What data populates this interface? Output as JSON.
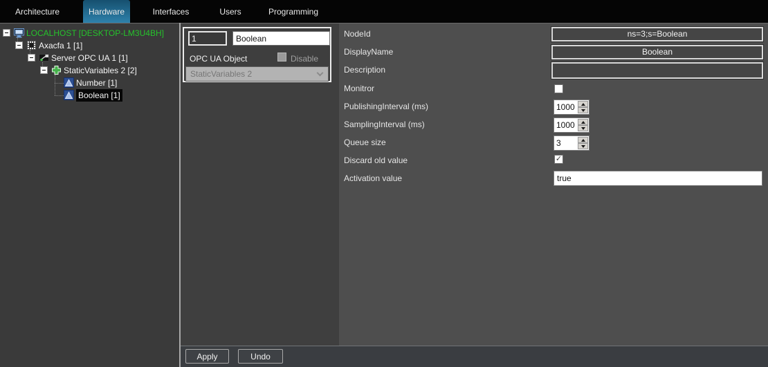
{
  "tabs": [
    {
      "label": "Architecture",
      "active": false
    },
    {
      "label": "Hardware",
      "active": true
    },
    {
      "label": "Interfaces",
      "active": false
    },
    {
      "label": "Users",
      "active": false
    },
    {
      "label": "Programming",
      "active": false
    }
  ],
  "tree": [
    {
      "label": "LOCALHOST [DESKTOP-LM3U4BH]",
      "icon": "monitor-icon",
      "level": 0,
      "expandable": true,
      "selected": false,
      "color": "#25c32b"
    },
    {
      "label": "Axacfa 1 [1]",
      "icon": "plc-icon",
      "level": 1,
      "expandable": true,
      "selected": false
    },
    {
      "label": "Server OPC UA 1 [1]",
      "icon": "opcua-server-icon",
      "level": 2,
      "expandable": true,
      "selected": false
    },
    {
      "label": "StaticVariables 2 [2]",
      "icon": "variables-group-icon",
      "level": 3,
      "expandable": true,
      "selected": false
    },
    {
      "label": "Number [1]",
      "icon": "variable-icon",
      "level": 4,
      "expandable": false,
      "selected": false
    },
    {
      "label": "Boolean [1]",
      "icon": "variable-icon",
      "level": 4,
      "expandable": false,
      "selected": true
    }
  ],
  "object_box": {
    "index_value": "1",
    "name_value": "Boolean",
    "type_label": "OPC UA Object",
    "disable_label": "Disable",
    "disable_checked": false,
    "parent_value": "StaticVariables 2"
  },
  "properties": [
    {
      "label": "NodeId",
      "type": "display",
      "value": "ns=3;s=Boolean"
    },
    {
      "label": "DisplayName",
      "type": "display",
      "value": "Boolean"
    },
    {
      "label": "Description",
      "type": "display",
      "value": ""
    },
    {
      "label": "Monitror",
      "type": "checkbox",
      "checked": false
    },
    {
      "label": "PublishingInterval (ms)",
      "type": "spinner",
      "value": "1000"
    },
    {
      "label": "SamplingInterval (ms)",
      "type": "spinner",
      "value": "1000"
    },
    {
      "label": "Queue size",
      "type": "spinner",
      "value": "3"
    },
    {
      "label": "Discard old value",
      "type": "checkbox",
      "checked": true
    },
    {
      "label": "Activation value",
      "type": "text",
      "value": "true"
    }
  ],
  "footer": {
    "apply_label": "Apply",
    "undo_label": "Undo"
  },
  "colors": {
    "active_tab_top": "#16506f",
    "active_tab_bottom": "#2e81ab",
    "localhost_green": "#25c32b",
    "selection_bg": "#070707",
    "tree_bg": "#3a3a3a",
    "form_bg": "#4e4e4e"
  }
}
